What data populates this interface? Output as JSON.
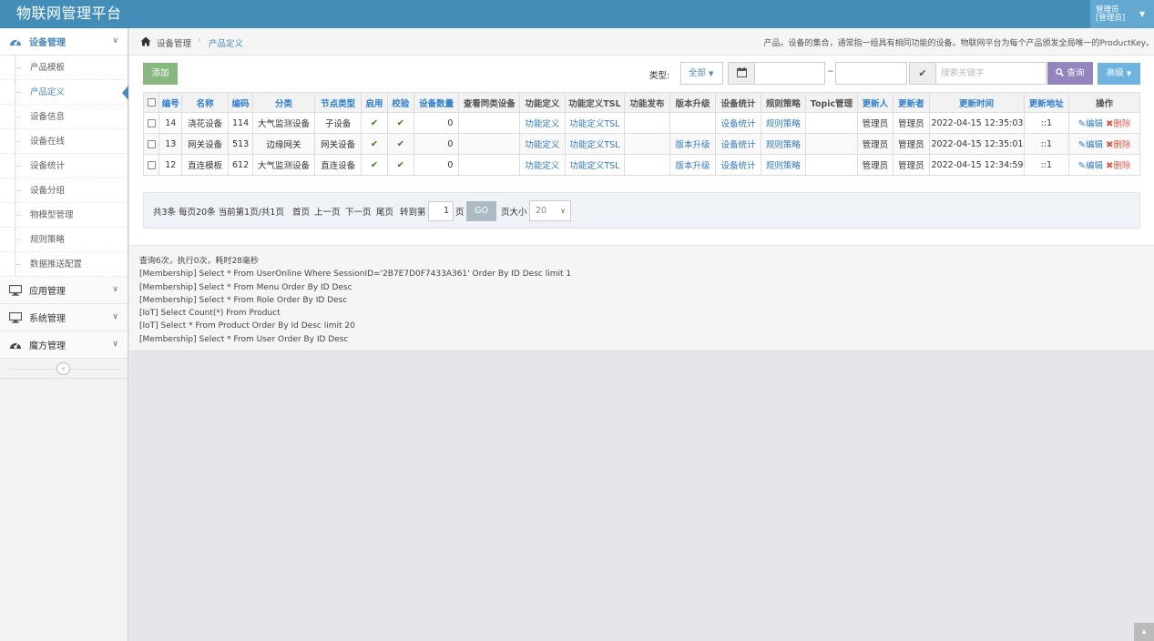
{
  "navbar": {
    "brand": "物联网管理平台",
    "user_line1": "管理员",
    "user_line2": "[管理员]",
    "caret_icon": "caret-down-icon"
  },
  "sidebar": {
    "groups": [
      {
        "label": "设备管理",
        "icon": "tachometer-icon",
        "open": true,
        "items": [
          "产品模板",
          "产品定义",
          "设备信息",
          "设备在线",
          "设备统计",
          "设备分组",
          "物模型管理",
          "规则策略",
          "数据推送配置"
        ],
        "active_item": "产品定义"
      },
      {
        "label": "应用管理",
        "icon": "desktop-icon",
        "open": false
      },
      {
        "label": "系统管理",
        "icon": "desktop-icon",
        "open": false
      },
      {
        "label": "魔方管理",
        "icon": "tachometer-icon",
        "open": false
      }
    ],
    "collapse_glyph": "«"
  },
  "breadcrumbs": {
    "home_icon": "home-icon",
    "level1": "设备管理",
    "separator": "›",
    "level2": "产品定义",
    "description": "产品。设备的集合，通常指一组具有相同功能的设备。物联网平台为每个产品颁发全局唯一的ProductKey。"
  },
  "toolbar": {
    "add_label": "添加",
    "type_label": "类型:",
    "type_value": "全部",
    "calendar_icon": "calendar-icon",
    "range_separator": "~",
    "check_icon": "check-icon",
    "search_placeholder": "搜索关键字",
    "query_label": "查询",
    "advanced_label": "高级"
  },
  "table": {
    "columns": [
      "",
      "编号",
      "名称",
      "编码",
      "分类",
      "节点类型",
      "启用",
      "校验",
      "设备数量",
      "查看同类设备",
      "功能定义",
      "功能定义TSL",
      "功能发布",
      "版本升级",
      "设备统计",
      "规则策略",
      "Topic管理",
      "更新人",
      "更新者",
      "更新时间",
      "更新地址",
      "操作"
    ],
    "rows": [
      {
        "id": "14",
        "name": "浇花设备",
        "code": "114",
        "category": "大气监测设备",
        "node_type": "子设备",
        "enabled": "✔",
        "verified": "✔",
        "count": "0",
        "same": "",
        "func": "功能定义",
        "tsl": "功能定义TSL",
        "publish": "",
        "upgrade": "",
        "stat": "设备统计",
        "rule": "规则策略",
        "topic": "",
        "updater": "管理员",
        "updated_by": "管理员",
        "time": "2022-04-15 12:35:03",
        "addr": "::1",
        "edit": "编辑",
        "del": "删除"
      },
      {
        "id": "13",
        "name": "网关设备",
        "code": "513",
        "category": "边缘网关",
        "node_type": "网关设备",
        "enabled": "✔",
        "verified": "✔",
        "count": "0",
        "same": "",
        "func": "功能定义",
        "tsl": "功能定义TSL",
        "publish": "",
        "upgrade": "版本升级",
        "stat": "设备统计",
        "rule": "规则策略",
        "topic": "",
        "updater": "管理员",
        "updated_by": "管理员",
        "time": "2022-04-15 12:35:01",
        "addr": "::1",
        "edit": "编辑",
        "del": "删除"
      },
      {
        "id": "12",
        "name": "直连模板",
        "code": "612",
        "category": "大气监测设备",
        "node_type": "直连设备",
        "enabled": "✔",
        "verified": "✔",
        "count": "0",
        "same": "",
        "func": "功能定义",
        "tsl": "功能定义TSL",
        "publish": "",
        "upgrade": "版本升级",
        "stat": "设备统计",
        "rule": "规则策略",
        "topic": "",
        "updater": "管理员",
        "updated_by": "管理员",
        "time": "2022-04-15 12:34:59",
        "addr": "::1",
        "edit": "编辑",
        "del": "删除"
      }
    ]
  },
  "pager": {
    "summary": "共3条  每页20条  当前第1页/共1页",
    "first": "首页",
    "prev": "上一页",
    "next": "下一页",
    "last": "尾页",
    "goto_label": "转到第",
    "page_value": "1",
    "page_unit": "页",
    "go_label": "GO",
    "size_label": "页大小",
    "size_value": "20"
  },
  "log": {
    "lines": [
      "查询6次，执行0次，耗时28毫秒",
      "[Membership] Select * From UserOnline Where SessionID='2B7E7D0F7433A361' Order By ID Desc limit 1",
      "[Membership] Select * From Menu Order By ID Desc",
      "[Membership] Select * From Role Order By ID Desc",
      "[IoT] Select Count(*) From Product",
      "[IoT] Select * From Product Order By Id Desc limit 20",
      "[Membership] Select * From User Order By ID Desc"
    ]
  },
  "colors": {
    "navbar": "#438eb9",
    "accent": "#4b88b7",
    "add_button": "#87b87f",
    "query_button": "#9585bf",
    "advanced_button": "#6fb3e0",
    "check": "#2b7a0b",
    "delete": "#d15b47"
  }
}
